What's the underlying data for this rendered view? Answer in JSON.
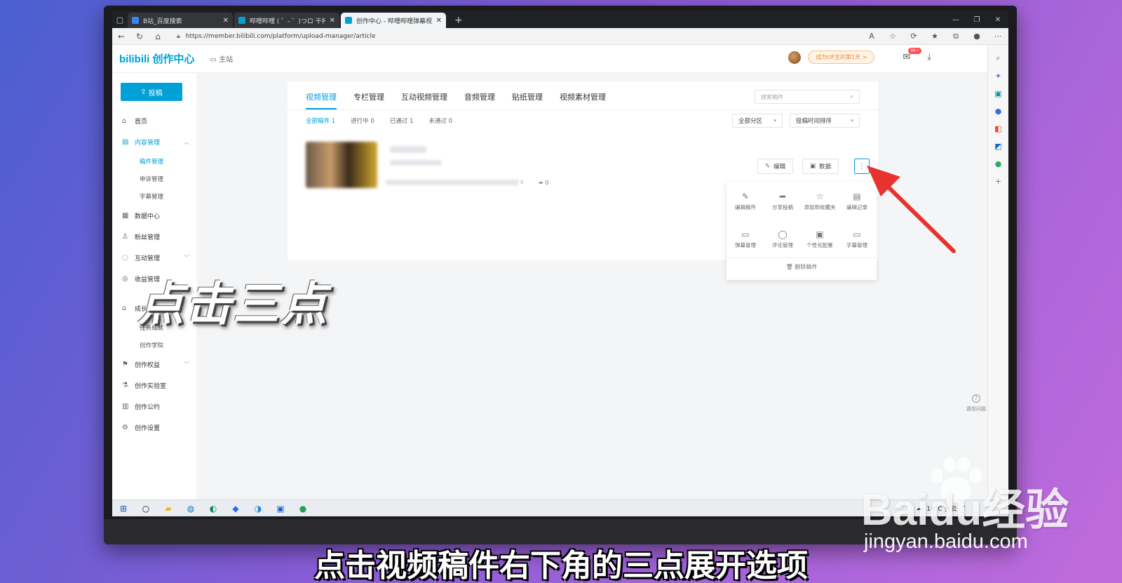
{
  "browser": {
    "tabs": [
      {
        "label": "B站_百度搜索",
        "color": "#3b82f6"
      },
      {
        "label": "哔哩哔哩 ( ゜- ゜)つロ 干杯~-bili",
        "color": "#00a1d6"
      },
      {
        "label": "创作中心 - 哔哩哔哩弹幕视频网",
        "color": "#00a1d6"
      }
    ],
    "new_tab": "+",
    "url": "https://member.bilibili.com/platform/upload-manager/article"
  },
  "header": {
    "logo": "bilibili 创作中心",
    "main_site": "主站",
    "promo": "成为UP主的第1天 >",
    "mail_badge": "99+"
  },
  "sidebar": {
    "upload_label": "投稿",
    "items": [
      {
        "label": "首页",
        "icon": "home-icon"
      },
      {
        "label": "内容管理",
        "icon": "document-icon",
        "active": true,
        "chev": "^"
      },
      {
        "label": "数据中心",
        "icon": "chart-icon"
      },
      {
        "label": "粉丝管理",
        "icon": "user-icon"
      },
      {
        "label": "互动管理",
        "icon": "chat-icon",
        "chev": "v"
      },
      {
        "label": "收益管理",
        "icon": "coin-icon"
      },
      {
        "label": "成长中心",
        "icon": "graduation-icon"
      },
      {
        "label": "创作权益",
        "icon": "flag-icon",
        "chev": "v"
      },
      {
        "label": "创作实验室",
        "icon": "flask-icon"
      },
      {
        "label": "创作公约",
        "icon": "notebook-icon"
      },
      {
        "label": "创作设置",
        "icon": "settings-icon"
      }
    ],
    "content_subs": [
      "稿件管理",
      "申诉管理",
      "字幕管理"
    ],
    "growth_subs": [
      "任务成就",
      "创作学院"
    ]
  },
  "main": {
    "tabs": [
      "视频管理",
      "专栏管理",
      "互动视频管理",
      "音频管理",
      "贴纸管理",
      "视频素材管理"
    ],
    "search_placeholder": "搜索稿件",
    "filters": [
      "全部稿件 1",
      "进行中 0",
      "已通过 1",
      "未通过 0"
    ],
    "zone_select": "全部分区",
    "sort_select": "投稿时间排序",
    "video": {
      "share_count": "0",
      "stat_zero": "0"
    },
    "edit_button": "编辑",
    "data_button": "数据"
  },
  "more_menu": {
    "items": [
      {
        "label": "编辑稿件",
        "icon": "pencil-icon"
      },
      {
        "label": "分享投稿",
        "icon": "share-icon"
      },
      {
        "label": "添加到收藏夹",
        "icon": "star-icon"
      },
      {
        "label": "编辑记录",
        "icon": "history-icon"
      },
      {
        "label": "弹幕管理",
        "icon": "danmaku-icon"
      },
      {
        "label": "评论管理",
        "icon": "comment-icon"
      },
      {
        "label": "个性化配置",
        "icon": "custom-icon"
      },
      {
        "label": "字幕管理",
        "icon": "subtitle-icon"
      }
    ],
    "delete_label": "删除稿件"
  },
  "help_float": "遇到问题",
  "taskbar": {
    "weather": "16°C 多云"
  },
  "overlay": {
    "caption": "点击三点",
    "subtitle": "点击视频稿件右下角的三点展开选项",
    "watermark_logo": "Baidu经验",
    "watermark_url": "jingyan.baidu.com"
  },
  "colors": {
    "accent": "#00a1d6",
    "arrow": "#e8322f"
  }
}
